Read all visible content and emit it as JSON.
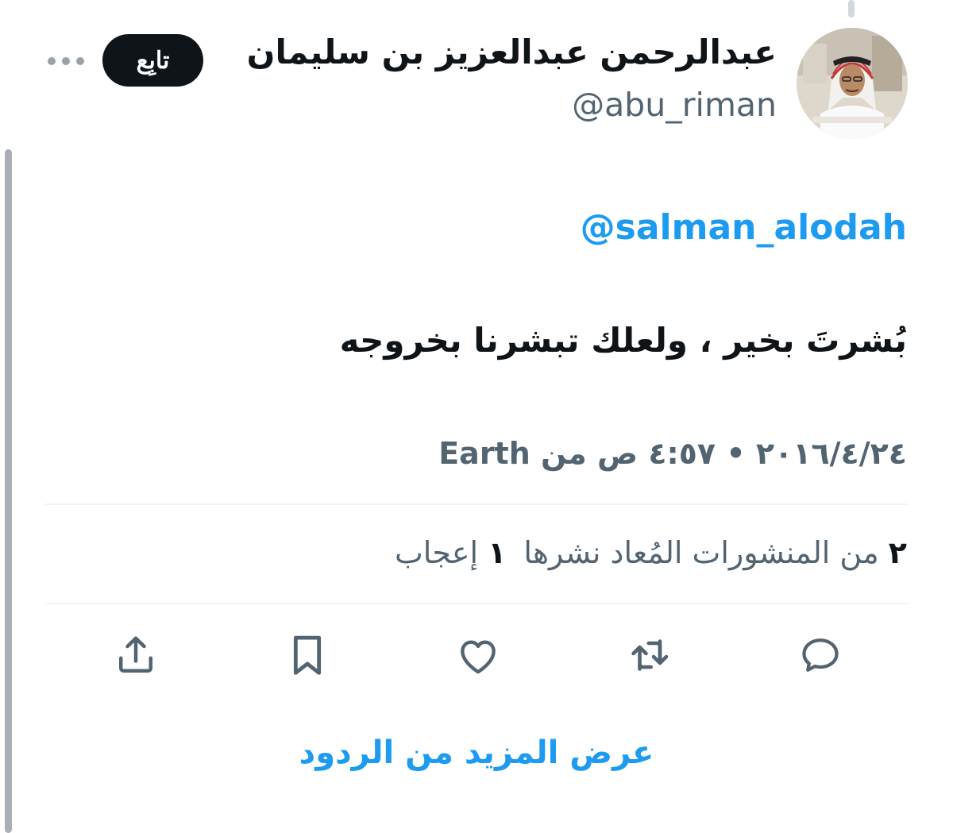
{
  "author": {
    "name": "عبدالرحمن عبدالعزيز بن سليمان",
    "handle": "@abu_riman"
  },
  "follow_button": {
    "label": "تابِع"
  },
  "tweet": {
    "mention": "@salman_alodah",
    "text": "بُشرتَ بخير ، ولعلك تبشرنا بخروجه",
    "date_time": "٢٠١٦/٤/٢٤ • ٤:٥٧ ص",
    "source_prefix": "من",
    "source": "Earth"
  },
  "stats": {
    "reposts_count": "٢",
    "reposts_label": "من المنشورات المُعاد نشرها",
    "likes_count": "١",
    "likes_label": "إعجاب"
  },
  "actions": {
    "icons": [
      "reply-icon",
      "repost-icon",
      "like-icon",
      "bookmark-icon",
      "share-icon"
    ]
  },
  "show_more_replies": "عرض المزيد من الردود",
  "colors": {
    "accent": "#1d9bf0",
    "text_primary": "#0f1419",
    "text_secondary": "#536471",
    "divider": "#eff3f4",
    "follow_button_bg": "#0f1419"
  }
}
